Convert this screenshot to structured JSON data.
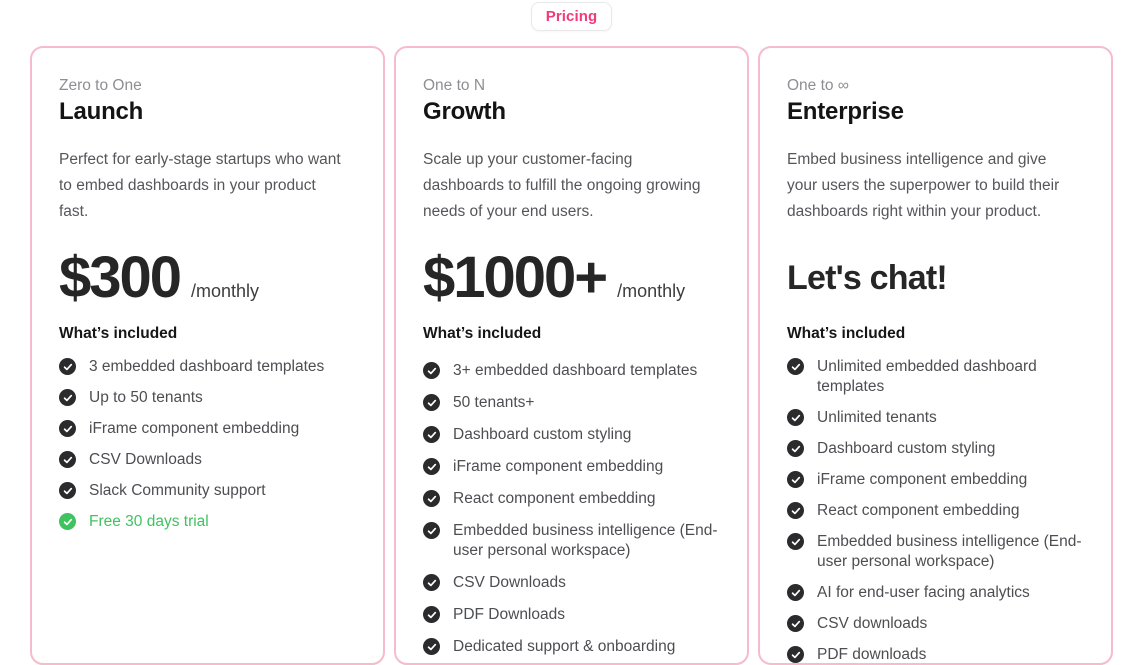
{
  "badge": {
    "label": "Pricing"
  },
  "colors": {
    "card_border": "#f6bbcd",
    "badge_text": "#f2397a",
    "check_dark": "#2b2b2d",
    "check_green": "#3fc35f",
    "highlight_text": "#3fc35f"
  },
  "included_heading": "What’s included",
  "plans": [
    {
      "eyebrow": "Zero to One",
      "name": "Launch",
      "description": "Perfect for early-stage startups who want to embed dashboards in your product fast.",
      "price": "$300",
      "period": "/monthly",
      "features": [
        {
          "text": "3 embedded dashboard templates",
          "highlight": false
        },
        {
          "text": "Up to 50 tenants",
          "highlight": false
        },
        {
          "text": "iFrame component embedding",
          "highlight": false
        },
        {
          "text": "CSV Downloads",
          "highlight": false
        },
        {
          "text": "Slack Community support",
          "highlight": false
        },
        {
          "text": "Free 30 days trial",
          "highlight": true
        }
      ]
    },
    {
      "eyebrow": "One to N",
      "name": "Growth",
      "description": "Scale up your customer-facing dashboards to fulfill the ongoing growing needs of your end users.",
      "price": "$1000+",
      "period": "/monthly",
      "features": [
        {
          "text": "3+ embedded dashboard templates",
          "highlight": false
        },
        {
          "text": "50 tenants+",
          "highlight": false
        },
        {
          "text": "Dashboard custom styling",
          "highlight": false
        },
        {
          "text": "iFrame component embedding",
          "highlight": false
        },
        {
          "text": "React component embedding",
          "highlight": false
        },
        {
          "text": "Embedded business intelligence (End-user personal workspace)",
          "highlight": false
        },
        {
          "text": "CSV Downloads",
          "highlight": false
        },
        {
          "text": "PDF Downloads",
          "highlight": false
        },
        {
          "text": "Dedicated support & onboarding",
          "highlight": false
        }
      ]
    },
    {
      "eyebrow": "One to ∞",
      "name": "Enterprise",
      "description": "Embed business intelligence and give your users the superpower to build their dashboards right within your product.",
      "price": "Let's chat!",
      "period": "",
      "features": [
        {
          "text": "Unlimited embedded dashboard templates",
          "highlight": false
        },
        {
          "text": "Unlimited tenants",
          "highlight": false
        },
        {
          "text": "Dashboard custom styling",
          "highlight": false
        },
        {
          "text": "iFrame component embedding",
          "highlight": false
        },
        {
          "text": "React component embedding",
          "highlight": false
        },
        {
          "text": "Embedded business intelligence (End-user personal workspace)",
          "highlight": false
        },
        {
          "text": "AI for end-user facing analytics",
          "highlight": false
        },
        {
          "text": "CSV downloads",
          "highlight": false
        },
        {
          "text": "PDF downloads",
          "highlight": false
        }
      ]
    }
  ]
}
